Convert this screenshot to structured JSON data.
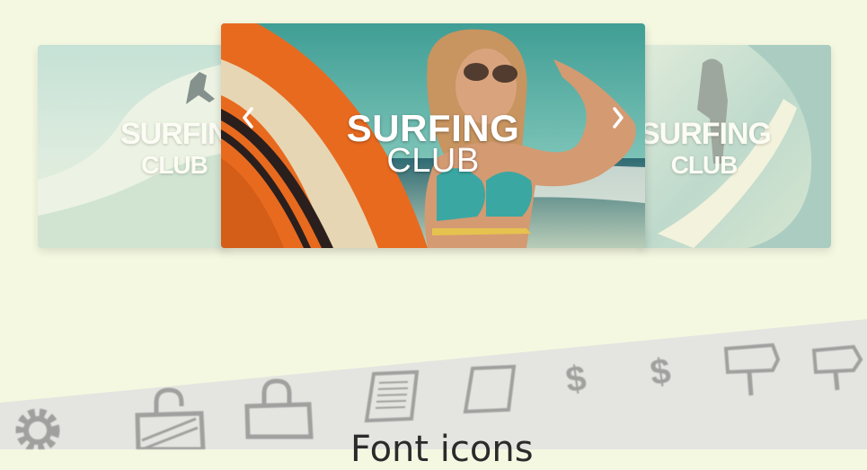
{
  "carousel": {
    "slides": [
      {
        "title_line1": "SURFING",
        "title_line2": "CLUB",
        "position": "left"
      },
      {
        "title_line1": "SURFING",
        "title_line2": "CLUB",
        "position": "center"
      },
      {
        "title_line1": "SURFING",
        "title_line2": "CLUB",
        "position": "right"
      }
    ],
    "prev_icon": "chevron-left-icon",
    "next_icon": "chevron-right-icon"
  },
  "icons_panel": {
    "heading": "Font icons",
    "icons": [
      "gear-icon",
      "unlocked-padlock-icon",
      "padlock-icon",
      "scroll-document-icon",
      "scroll-icon",
      "dollar-icon",
      "dollar-icon",
      "signpost-icon",
      "signpost-icon"
    ]
  },
  "colors": {
    "page_background": "#f5f8e1",
    "panel_background": "#e4e5e0",
    "icon_color": "#8a8a8a"
  }
}
